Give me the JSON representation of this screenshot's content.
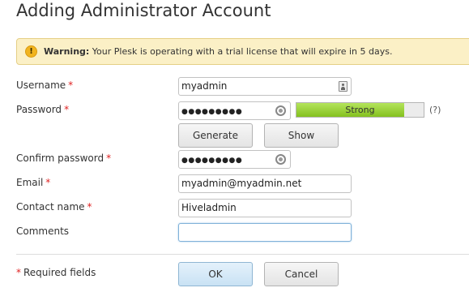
{
  "page": {
    "title": "Adding Administrator Account"
  },
  "warning": {
    "icon": "warning-icon",
    "label": "Warning:",
    "message": "Your Plesk is operating with a trial license that will expire in 5 days."
  },
  "form": {
    "required_marker": "*",
    "username": {
      "label": "Username",
      "value": "myadmin",
      "icon": "user-card-icon"
    },
    "password": {
      "label": "Password",
      "masked_value": "●●●●●●●●●",
      "icon": "reveal-icon",
      "strength": {
        "label": "Strong",
        "level": 0.85,
        "color": "#8ccb2a"
      },
      "help": "(?)",
      "generate_label": "Generate",
      "show_label": "Show"
    },
    "confirm_password": {
      "label": "Confirm password",
      "masked_value": "●●●●●●●●●",
      "icon": "reveal-icon"
    },
    "email": {
      "label": "Email",
      "value": "myadmin@myadmin.net"
    },
    "contact_name": {
      "label": "Contact name",
      "value": "Hiveladmin"
    },
    "comments": {
      "label": "Comments",
      "value": ""
    }
  },
  "footer": {
    "required_note": "Required fields",
    "ok_label": "OK",
    "cancel_label": "Cancel"
  }
}
